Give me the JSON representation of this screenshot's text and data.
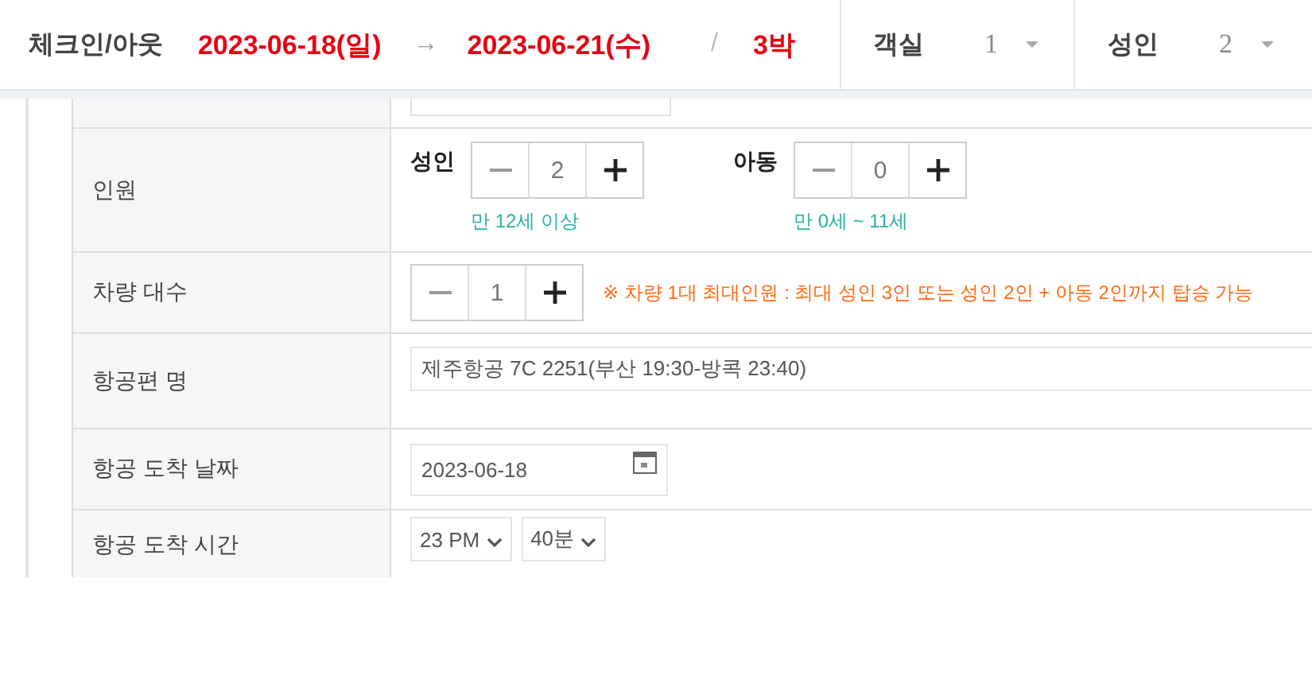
{
  "header": {
    "label": "체크인/아웃",
    "checkin": "2023-06-18(일)",
    "arrow": "→",
    "checkout": "2023-06-21(수)",
    "separator": "/",
    "nights": "3박",
    "selectors": [
      {
        "label": "객실",
        "value": "1"
      },
      {
        "label": "성인",
        "value": "2"
      }
    ]
  },
  "rows": [
    {
      "kind": "counters",
      "label": "인원",
      "counters": [
        {
          "label": "성인",
          "value": "2",
          "note": "만 12세 이상"
        },
        {
          "label": "아동",
          "value": "0",
          "note": "만 0세 ~ 11세"
        }
      ]
    },
    {
      "kind": "counter",
      "label": "차량 대수",
      "value": "1",
      "note": "※ 차량 1대 최대인원 : 최대 성인 3인 또는 성인 2인 + 아동 2인까지 탑승 가능"
    },
    {
      "kind": "text",
      "label": "항공편 명",
      "value": "제주항공 7C 2251(부산 19:30-방콕 23:40)"
    },
    {
      "kind": "date",
      "label": "항공 도착 날짜",
      "value": "2023-06-18"
    },
    {
      "kind": "selects",
      "label": "항공 도착 시간",
      "selects": [
        "23 PM",
        "40분"
      ]
    }
  ]
}
